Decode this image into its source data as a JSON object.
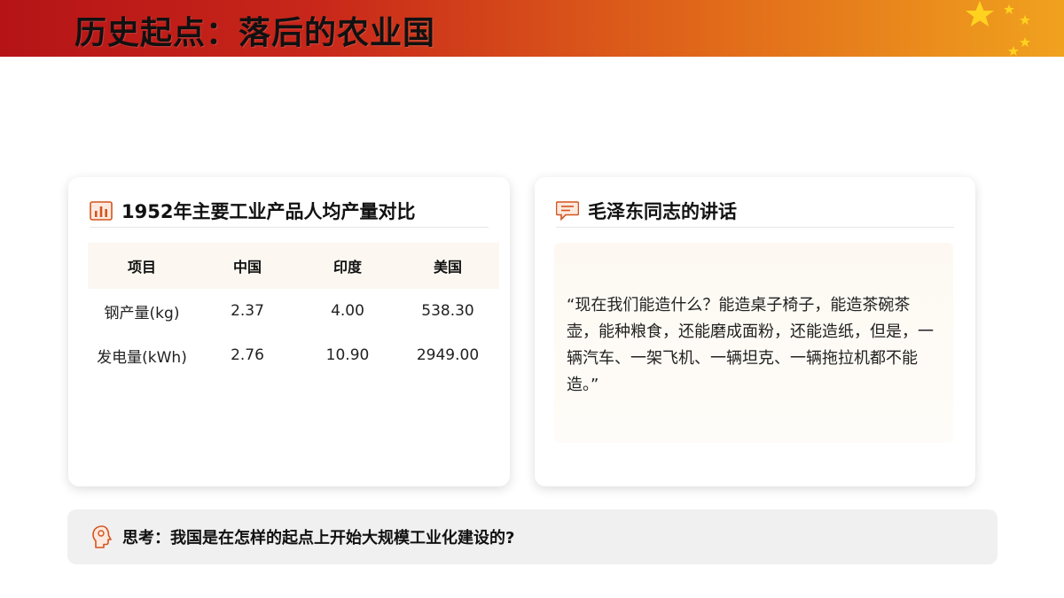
{
  "header": {
    "title": "历史起点：落后的农业国"
  },
  "left_card": {
    "title": "1952年主要工业产品人均产量对比",
    "icon": "bar-chart-icon",
    "table": {
      "headers": [
        "项目",
        "中国",
        "印度",
        "美国"
      ],
      "rows": [
        [
          "钢产量(kg)",
          "2.37",
          "4.00",
          "538.30"
        ],
        [
          "发电量(kWh)",
          "2.76",
          "10.90",
          "2949.00"
        ]
      ]
    }
  },
  "right_card": {
    "title": "毛泽东同志的讲话",
    "icon": "speech-bubble-icon",
    "quote": "“现在我们能造什么？能造桌子椅子，能造茶碗茶壶，能种粮食，还能磨成面粉，还能造纸，但是，一辆汽车、一架飞机、一辆坦克、一辆拖拉机都不能造。”"
  },
  "think": {
    "icon": "head-thinking-icon",
    "text": "思考：我国是在怎样的起点上开始大规模工业化建设的?"
  },
  "colors": {
    "header_start": "#b51417",
    "header_end": "#f0a21e",
    "accent": "#d4541e",
    "star": "#ffd21f"
  }
}
